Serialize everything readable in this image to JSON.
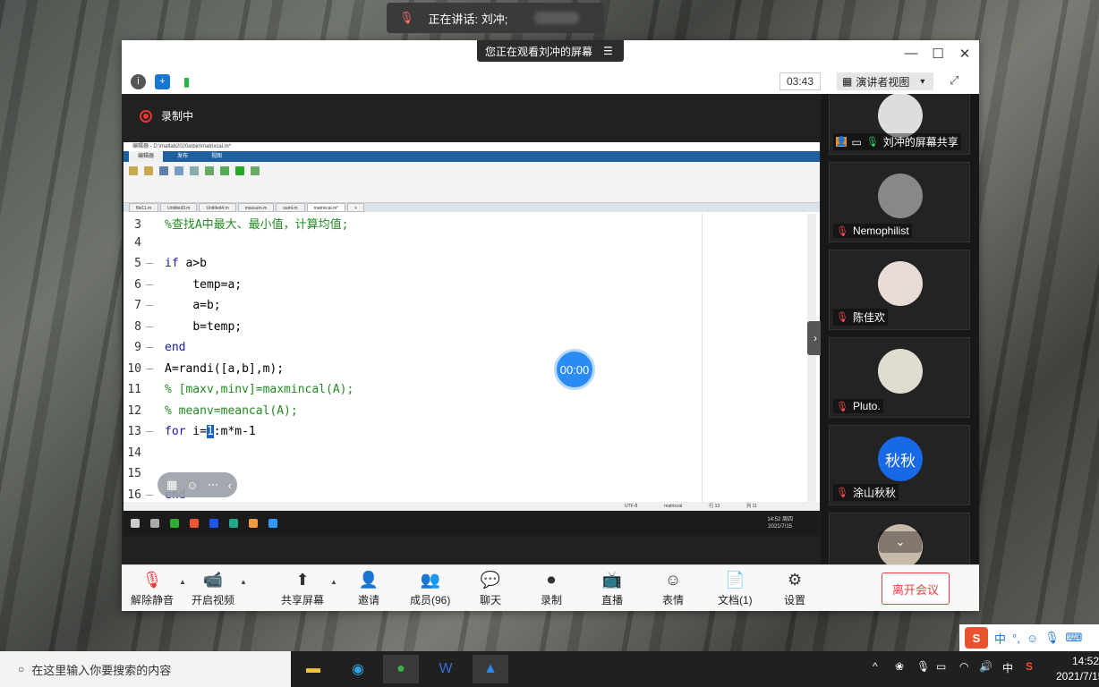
{
  "banner": {
    "speaking_text": "正在讲话: 刘冲;"
  },
  "window": {
    "viewing_text": "您正在观看刘冲的屏幕",
    "minimize": "—",
    "maximize": "☐",
    "close": "✕"
  },
  "toolbar": {
    "info": "i",
    "shield": "+",
    "signal": "▮",
    "timer": "03:43",
    "view_label": "演讲者视图",
    "view_caret": "▾",
    "fullscreen": "⤢"
  },
  "stage": {
    "recording_label": "录制中",
    "float_timer": "00:00",
    "side_handle": "›",
    "mini_tools": [
      "▦",
      "☺",
      "⋯",
      "‹"
    ]
  },
  "matlab": {
    "title": "编辑器 - D:\\matlab2020a\\bin\\matrixcal.m*",
    "tabs": [
      "编辑器",
      "发布",
      "视图"
    ],
    "file_tabs": [
      "file11.m",
      "Untitled3.m",
      "Untitled4.m",
      "maxsum.m",
      "sumt.m",
      "matrixcal.m*",
      "+"
    ],
    "status": [
      "UTF-8",
      "matrixcal",
      "行 13",
      "列 11"
    ],
    "clock": [
      "14:52 周四",
      "2021/7/15"
    ],
    "lines": [
      {
        "num": "3",
        "dash": "",
        "indent": "",
        "parts": [
          {
            "t": "%查找A中最大、最小值，计算均值;",
            "c": "cm"
          }
        ]
      },
      {
        "num": "4",
        "dash": "",
        "indent": "",
        "parts": []
      },
      {
        "num": "5",
        "dash": "—",
        "indent": "",
        "parts": [
          {
            "t": "if",
            "c": "kw"
          },
          {
            "t": " a>b",
            "c": ""
          }
        ]
      },
      {
        "num": "6",
        "dash": "—",
        "indent": "    ",
        "parts": [
          {
            "t": "temp=a;",
            "c": ""
          }
        ]
      },
      {
        "num": "7",
        "dash": "—",
        "indent": "    ",
        "parts": [
          {
            "t": "a=b;",
            "c": ""
          }
        ]
      },
      {
        "num": "8",
        "dash": "—",
        "indent": "    ",
        "parts": [
          {
            "t": "b=temp;",
            "c": ""
          }
        ]
      },
      {
        "num": "9",
        "dash": "—",
        "indent": "",
        "parts": [
          {
            "t": "end",
            "c": "kw"
          }
        ]
      },
      {
        "num": "10",
        "dash": "—",
        "indent": "",
        "parts": [
          {
            "t": "A=randi([a,b],m);",
            "c": ""
          }
        ]
      },
      {
        "num": "11",
        "dash": "",
        "indent": "",
        "parts": [
          {
            "t": "% [maxv,minv]=maxmincal(A);",
            "c": "cm"
          }
        ]
      },
      {
        "num": "12",
        "dash": "",
        "indent": "",
        "parts": [
          {
            "t": "% meanv=meancal(A);",
            "c": "cm"
          }
        ]
      },
      {
        "num": "13",
        "dash": "—",
        "indent": "",
        "parts": [
          {
            "t": "for",
            "c": "kw"
          },
          {
            "t": " i=",
            "c": ""
          },
          {
            "t": "1",
            "c": "hl"
          },
          {
            "t": ":m*m-1",
            "c": ""
          }
        ]
      },
      {
        "num": "14",
        "dash": "",
        "indent": "",
        "parts": []
      },
      {
        "num": "15",
        "dash": "",
        "indent": "",
        "parts": []
      },
      {
        "num": "16",
        "dash": "—",
        "indent": "",
        "parts": [
          {
            "t": "end",
            "c": "kw"
          }
        ]
      }
    ]
  },
  "participants": [
    {
      "name": "刘冲的屏幕共享",
      "avatar_text": "",
      "avatar_color": "#ddd",
      "is_host": true
    },
    {
      "name": "Nemophilist",
      "avatar_text": "",
      "avatar_color": "#888"
    },
    {
      "name": "陈佳欢",
      "avatar_text": "",
      "avatar_color": "#e8dcd6"
    },
    {
      "name": "Pluto.",
      "avatar_text": "",
      "avatar_color": "#e0ddd0"
    },
    {
      "name": "涂山秋秋",
      "avatar_text": "秋秋",
      "avatar_color": "#1769e6"
    },
    {
      "name": "",
      "avatar_text": "",
      "avatar_color": "#c9b9a9"
    }
  ],
  "participants_scroll": "⌄",
  "bottom_bar": {
    "buttons": [
      {
        "label": "解除静音",
        "icon": "🎙"
      },
      {
        "label": "开启视频",
        "icon": "📹"
      },
      {
        "label": "共享屏幕",
        "icon": "⬆"
      },
      {
        "label": "邀请",
        "icon": "👤"
      },
      {
        "label": "成员(96)",
        "icon": "👥"
      },
      {
        "label": "聊天",
        "icon": "💬"
      },
      {
        "label": "录制",
        "icon": "⏺"
      },
      {
        "label": "直播",
        "icon": "📺"
      },
      {
        "label": "表情",
        "icon": "☺"
      },
      {
        "label": "文档(1)",
        "icon": "📄"
      },
      {
        "label": "设置",
        "icon": "⚙"
      }
    ],
    "leave_label": "离开会议"
  },
  "taskbar": {
    "search_placeholder": "在这里输入你要搜索的内容",
    "ime": "中",
    "time": "14:52",
    "date": "2021/7/15"
  },
  "ime_bar": [
    "中",
    "°,",
    "☺",
    "🎙",
    "⌨"
  ],
  "colors": {
    "accent": "#2a8bf2",
    "danger": "#e84343",
    "matlab_blue": "#1e5fa0"
  }
}
